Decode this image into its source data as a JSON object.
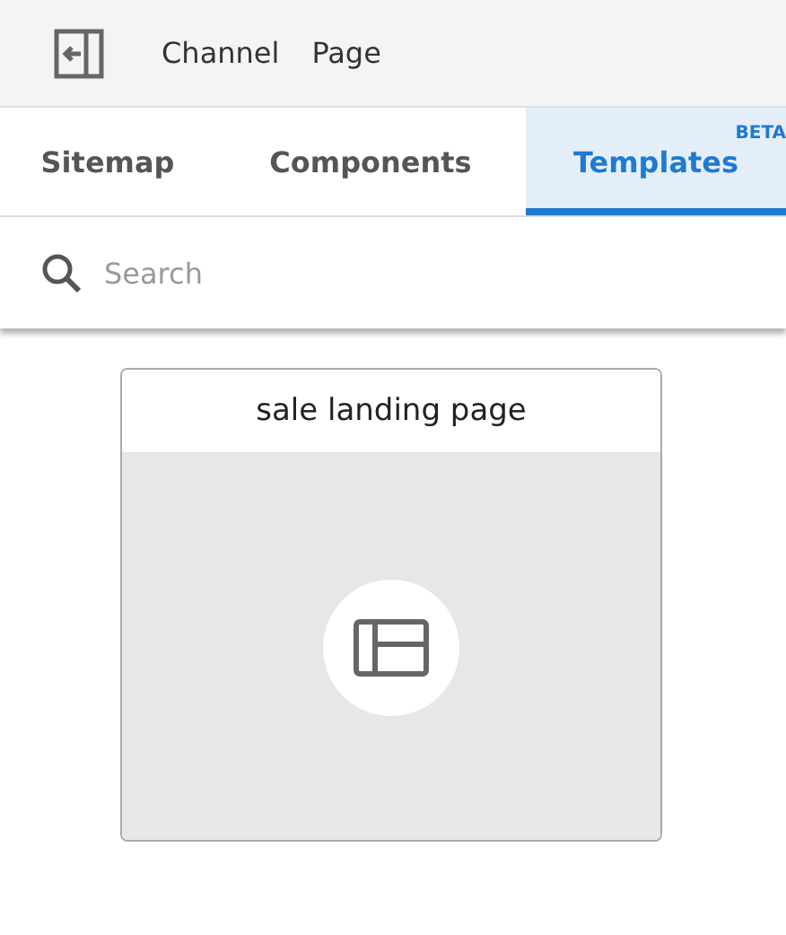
{
  "toolbar": {
    "links": [
      "Channel",
      "Page"
    ]
  },
  "tabs": [
    {
      "label": "Sitemap",
      "selected": false
    },
    {
      "label": "Components",
      "selected": false
    },
    {
      "label": "Templates",
      "selected": true,
      "badge": "BETA"
    }
  ],
  "search": {
    "placeholder": "Search"
  },
  "templates": [
    {
      "name": "sale landing page"
    }
  ]
}
